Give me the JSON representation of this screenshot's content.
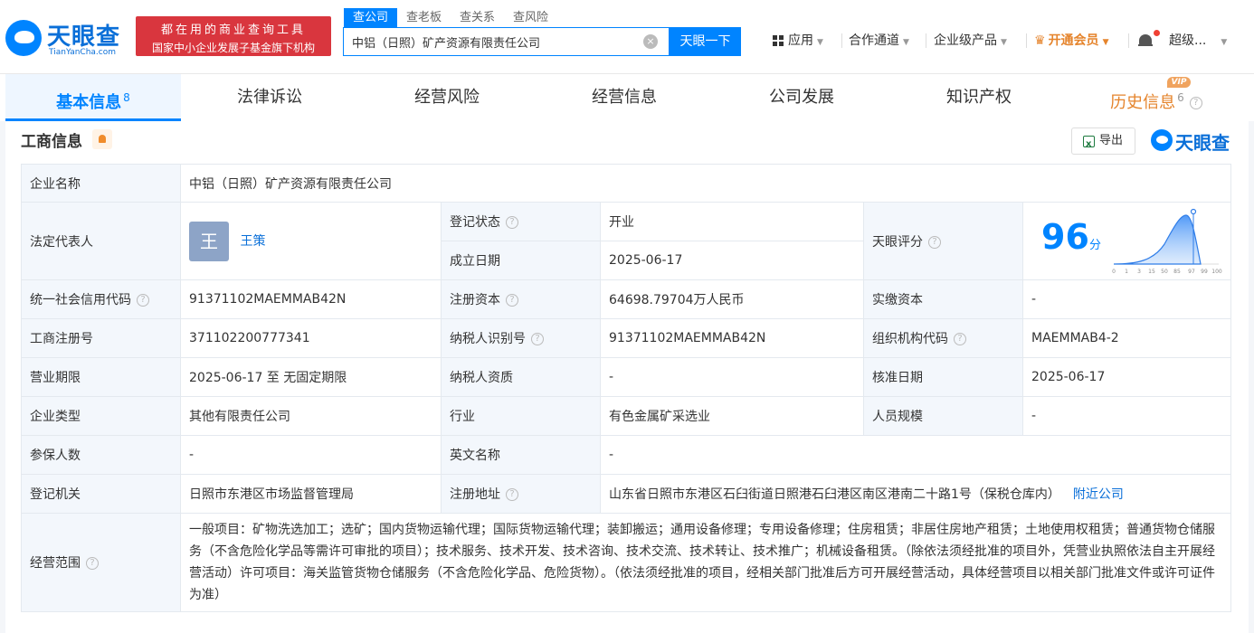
{
  "header": {
    "logo_cn": "天眼查",
    "logo_en": "TianYanCha.com",
    "promo_line1": "都在用的商业查询工具",
    "promo_line2": "国家中小企业发展子基金旗下机构",
    "search_tabs": [
      "查公司",
      "查老板",
      "查关系",
      "查风险"
    ],
    "search_value": "中铝（日照）矿产资源有限责任公司",
    "clear_symbol": "×",
    "search_button": "天眼一下",
    "nav": {
      "apps": "应用",
      "partner": "合作通道",
      "enterprise": "企业级产品",
      "vip": "开通会员",
      "user": "超级..."
    }
  },
  "tabs": [
    {
      "label": "基本信息",
      "count": "8"
    },
    {
      "label": "法律诉讼",
      "count": ""
    },
    {
      "label": "经营风险",
      "count": ""
    },
    {
      "label": "经营信息",
      "count": ""
    },
    {
      "label": "公司发展",
      "count": ""
    },
    {
      "label": "知识产权",
      "count": ""
    },
    {
      "label": "历史信息",
      "count": "6"
    }
  ],
  "vip_badge": "VIP",
  "section": {
    "title": "工商信息",
    "export_label": "导出",
    "brand": "天眼查"
  },
  "info": {
    "company_name_label": "企业名称",
    "company_name": "中铝（日照）矿产资源有限责任公司",
    "legal_rep_label": "法定代表人",
    "legal_rep_avatar": "王",
    "legal_rep": "王策",
    "reg_status_label": "登记状态",
    "reg_status": "开业",
    "est_date_label": "成立日期",
    "est_date": "2025-06-17",
    "score_label": "天眼评分",
    "score": "96",
    "score_unit": "分",
    "score_ticks": [
      "0",
      "1",
      "3",
      "15",
      "50",
      "85",
      "97",
      "99",
      "100"
    ],
    "credit_code_label": "统一社会信用代码",
    "credit_code": "91371102MAEMMAB42N",
    "reg_capital_label": "注册资本",
    "reg_capital": "64698.79704万人民币",
    "paid_capital_label": "实缴资本",
    "paid_capital": "-",
    "reg_no_label": "工商注册号",
    "reg_no": "371102200777341",
    "taxpayer_id_label": "纳税人识别号",
    "taxpayer_id": "91371102MAEMMAB42N",
    "org_code_label": "组织机构代码",
    "org_code": "MAEMMAB4-2",
    "term_label": "营业期限",
    "term": "2025-06-17 至 无固定期限",
    "tax_qual_label": "纳税人资质",
    "tax_qual": "-",
    "approval_date_label": "核准日期",
    "approval_date": "2025-06-17",
    "type_label": "企业类型",
    "type": "其他有限责任公司",
    "industry_label": "行业",
    "industry": "有色金属矿采选业",
    "staff_label": "人员规模",
    "staff": "-",
    "insured_label": "参保人数",
    "insured": "-",
    "en_name_label": "英文名称",
    "en_name": "-",
    "authority_label": "登记机关",
    "authority": "日照市东港区市场监督管理局",
    "address_label": "注册地址",
    "address": "山东省日照市东港区石臼街道日照港石臼港区南区港南二十路1号（保税仓库内）",
    "nearby_link": "附近公司",
    "scope_label": "经营范围",
    "scope": "一般项目：矿物洗选加工；选矿；国内货物运输代理；国际货物运输代理；装卸搬运；通用设备修理；专用设备修理；住房租赁；非居住房地产租赁；土地使用权租赁；普通货物仓储服务（不含危险化学品等需许可审批的项目）；技术服务、技术开发、技术咨询、技术交流、技术转让、技术推广；机械设备租赁。（除依法须经批准的项目外，凭营业执照依法自主开展经营活动）许可项目：海关监管货物仓储服务（不含危险化学品、危险货物）。（依法须经批准的项目，经相关部门批准后方可开展经营活动，具体经营项目以相关部门批准文件或许可证件为准）"
  },
  "colors": {
    "brand_blue": "#0084ff",
    "promo_red": "#d9363e",
    "vip_orange": "#e5842c",
    "status_green": "#24a148"
  }
}
